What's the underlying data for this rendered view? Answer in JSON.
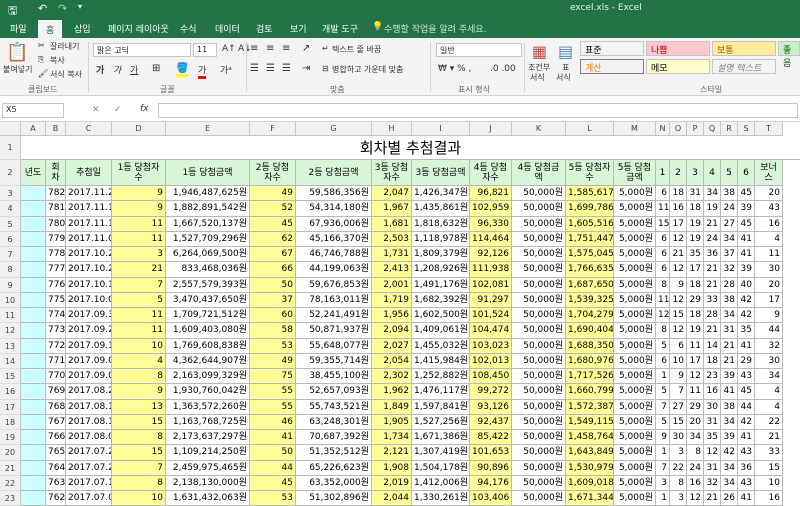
{
  "titlebar": {
    "title": "excel.xls - Excel",
    "save_icon": "save-icon",
    "undo_icon": "undo-icon",
    "redo_icon": "redo-icon"
  },
  "tabs": [
    "파일",
    "홈",
    "삽입",
    "페이지 레이아웃",
    "수식",
    "데이터",
    "검토",
    "보기",
    "개발 도구"
  ],
  "tell_me": "수행할 작업을 알려 주세요.",
  "ribbon": {
    "paste": "붙여넣기",
    "cut": "잘라내기",
    "copy": "복사",
    "format_painter": "서식 복사",
    "font": "맑은 고딕",
    "size": "11",
    "bold": "가",
    "italic": "가",
    "underline": "가",
    "wrap": "텍스트 줄 바꿈",
    "merge": "병합하고 가운데 맞춤",
    "number_format": "일반",
    "cond": "조건부",
    "cond2": "서식",
    "table_fmt": "표",
    "table_fmt2": "서식",
    "styles": [
      {
        "label": "표준",
        "bg": "#ffffff",
        "fg": "#000000"
      },
      {
        "label": "나쁨",
        "bg": "#ffc7ce",
        "fg": "#9c0006"
      },
      {
        "label": "보통",
        "bg": "#ffeb9c",
        "fg": "#9c6500"
      },
      {
        "label": "좋음",
        "bg": "#c6efce",
        "fg": "#006100"
      },
      {
        "label": "계산",
        "bg": "#f2f2f2",
        "fg": "#fa7d00"
      },
      {
        "label": "메모",
        "bg": "#ffffcc",
        "fg": "#000000"
      },
      {
        "label": "설명 텍스트",
        "bg": "#ffffff",
        "fg": "#7f7f7f"
      }
    ],
    "groups": [
      "클립보드",
      "글꼴",
      "맞춤",
      "표시 형식",
      "스타일"
    ]
  },
  "formula_bar": {
    "name_box": "X5",
    "fx": "fx",
    "value": ""
  },
  "columns": [
    "A",
    "B",
    "C",
    "D",
    "E",
    "F",
    "G",
    "H",
    "I",
    "J",
    "K",
    "L",
    "M",
    "N",
    "O",
    "P",
    "Q",
    "R",
    "S",
    "T"
  ],
  "sheet_title": "회차별 추첨결과",
  "headers": [
    "년도",
    "회차",
    "추첨일",
    "1등 당첨자수",
    "1등 당첨금액",
    "2등 당첨자수",
    "2등 당첨금액",
    "3등 당첨자수",
    "3등 당첨금액",
    "4등 당첨자수",
    "4등 당첨금액",
    "5등 당첨자수",
    "5등 당첨금액",
    "1",
    "2",
    "3",
    "4",
    "5",
    "6",
    "보너스"
  ],
  "rows": [
    [
      "",
      "782",
      "2017.11.25",
      "9",
      "1,946,487,625원",
      "49",
      "59,586,356원",
      "2,047",
      "1,426,347원",
      "96,821",
      "50,000원",
      "1,585,617",
      "5,000원",
      "6",
      "18",
      "31",
      "34",
      "38",
      "45",
      "20"
    ],
    [
      "",
      "781",
      "2017.11.18",
      "9",
      "1,882,891,542원",
      "52",
      "54,314,180원",
      "1,967",
      "1,435,861원",
      "102,959",
      "50,000원",
      "1,699,786",
      "5,000원",
      "11",
      "16",
      "18",
      "19",
      "24",
      "39",
      "43"
    ],
    [
      "",
      "780",
      "2017.11.11",
      "11",
      "1,667,520,137원",
      "45",
      "67,936,006원",
      "1,681",
      "1,818,632원",
      "96,330",
      "50,000원",
      "1,605,516",
      "5,000원",
      "15",
      "17",
      "19",
      "21",
      "27",
      "45",
      "16"
    ],
    [
      "",
      "779",
      "2017.11.04",
      "11",
      "1,527,709,296원",
      "62",
      "45,166,370원",
      "2,503",
      "1,118,978원",
      "114,464",
      "50,000원",
      "1,751,447",
      "5,000원",
      "6",
      "12",
      "19",
      "24",
      "34",
      "41",
      "4"
    ],
    [
      "",
      "778",
      "2017.10.28",
      "3",
      "6,264,069,500원",
      "67",
      "46,746,788원",
      "1,731",
      "1,809,379원",
      "92,126",
      "50,000원",
      "1,575,045",
      "5,000원",
      "6",
      "21",
      "35",
      "36",
      "37",
      "41",
      "11"
    ],
    [
      "",
      "777",
      "2017.10.21",
      "21",
      "833,468,036원",
      "66",
      "44,199,063원",
      "2,413",
      "1,208,926원",
      "111,938",
      "50,000원",
      "1,766,635",
      "5,000원",
      "6",
      "12",
      "17",
      "21",
      "32",
      "39",
      "30"
    ],
    [
      "",
      "776",
      "2017.10.14",
      "7",
      "2,557,579,393원",
      "50",
      "59,676,853원",
      "2,001",
      "1,491,176원",
      "102,081",
      "50,000원",
      "1,687,650",
      "5,000원",
      "8",
      "9",
      "18",
      "21",
      "28",
      "40",
      "20"
    ],
    [
      "",
      "775",
      "2017.10.07",
      "5",
      "3,470,437,650원",
      "37",
      "78,163,011원",
      "1,719",
      "1,682,392원",
      "91,297",
      "50,000원",
      "1,539,325",
      "5,000원",
      "11",
      "12",
      "29",
      "33",
      "38",
      "42",
      "17"
    ],
    [
      "",
      "774",
      "2017.09.30",
      "11",
      "1,709,721,512원",
      "60",
      "52,241,491원",
      "1,956",
      "1,602,500원",
      "101,524",
      "50,000원",
      "1,704,279",
      "5,000원",
      "12",
      "15",
      "18",
      "28",
      "34",
      "42",
      "9"
    ],
    [
      "",
      "773",
      "2017.09.23",
      "11",
      "1,609,403,080원",
      "58",
      "50,871,937원",
      "2,094",
      "1,409,061원",
      "104,474",
      "50,000원",
      "1,690,404",
      "5,000원",
      "8",
      "12",
      "19",
      "21",
      "31",
      "35",
      "44"
    ],
    [
      "",
      "772",
      "2017.09.16",
      "10",
      "1,769,608,838원",
      "53",
      "55,648,077원",
      "2,027",
      "1,455,032원",
      "103,023",
      "50,000원",
      "1,688,350",
      "5,000원",
      "5",
      "6",
      "11",
      "14",
      "21",
      "41",
      "32"
    ],
    [
      "",
      "771",
      "2017.09.09",
      "4",
      "4,362,644,907원",
      "49",
      "59,355,714원",
      "2,054",
      "1,415,984원",
      "102,013",
      "50,000원",
      "1,680,976",
      "5,000원",
      "6",
      "10",
      "17",
      "18",
      "21",
      "29",
      "30"
    ],
    [
      "",
      "770",
      "2017.09.02",
      "8",
      "2,163,099,329원",
      "75",
      "38,455,100원",
      "2,302",
      "1,252,882원",
      "108,450",
      "50,000원",
      "1,717,526",
      "5,000원",
      "1",
      "9",
      "12",
      "23",
      "39",
      "43",
      "34"
    ],
    [
      "",
      "769",
      "2017.08.26",
      "9",
      "1,930,760,042원",
      "55",
      "52,657,093원",
      "1,962",
      "1,476,117원",
      "99,272",
      "50,000원",
      "1,660,799",
      "5,000원",
      "5",
      "7",
      "11",
      "16",
      "41",
      "45",
      "4"
    ],
    [
      "",
      "768",
      "2017.08.19",
      "13",
      "1,363,572,260원",
      "55",
      "55,743,521원",
      "1,849",
      "1,597,841원",
      "93,126",
      "50,000원",
      "1,572,387",
      "5,000원",
      "7",
      "27",
      "29",
      "30",
      "38",
      "44",
      "4"
    ],
    [
      "",
      "767",
      "2017.08.12",
      "15",
      "1,163,768,725원",
      "46",
      "63,248,301원",
      "1,905",
      "1,527,256원",
      "92,437",
      "50,000원",
      "1,549,115",
      "5,000원",
      "5",
      "15",
      "20",
      "31",
      "34",
      "42",
      "22"
    ],
    [
      "",
      "766",
      "2017.08.05",
      "8",
      "2,173,637,297원",
      "41",
      "70,687,392원",
      "1,734",
      "1,671,386원",
      "85,422",
      "50,000원",
      "1,458,764",
      "5,000원",
      "9",
      "30",
      "34",
      "35",
      "39",
      "41",
      "21"
    ],
    [
      "",
      "765",
      "2017.07.29",
      "15",
      "1,109,214,250원",
      "50",
      "51,352,512원",
      "2,121",
      "1,307,419원",
      "101,653",
      "50,000원",
      "1,643,849",
      "5,000원",
      "1",
      "3",
      "8",
      "12",
      "42",
      "43",
      "33"
    ],
    [
      "",
      "764",
      "2017.07.22",
      "7",
      "2,459,975,465원",
      "44",
      "65,226,623원",
      "1,908",
      "1,504,178원",
      "90,896",
      "50,000원",
      "1,530,979",
      "5,000원",
      "7",
      "22",
      "24",
      "31",
      "34",
      "36",
      "15"
    ],
    [
      "",
      "763",
      "2017.07.15",
      "8",
      "2,138,130,000원",
      "45",
      "63,352,000원",
      "2,019",
      "1,412,006원",
      "94,176",
      "50,000원",
      "1,609,018",
      "5,000원",
      "3",
      "8",
      "16",
      "32",
      "34",
      "43",
      "10"
    ],
    [
      "",
      "762",
      "2017.07.08",
      "10",
      "1,631,432,063원",
      "53",
      "51,302,896원",
      "2,044",
      "1,330,261원",
      "103,406",
      "50,000원",
      "1,671,344",
      "5,000원",
      "1",
      "3",
      "12",
      "21",
      "26",
      "41",
      "16"
    ],
    [
      "",
      "761",
      "2017.07.01",
      "7",
      "2,392,730,518원",
      "52",
      "53,683,057원",
      "2,139",
      "1,305,058원",
      "101,503",
      "50,000원",
      "1,660,130",
      "5,000원",
      "4",
      "7",
      "11",
      "24",
      "42",
      "45",
      "30"
    ]
  ],
  "row_numbers": [
    "1",
    "2",
    "3",
    "4",
    "5",
    "6",
    "7",
    "8",
    "9",
    "10",
    "11",
    "12",
    "13",
    "14",
    "15",
    "16",
    "17",
    "18",
    "19",
    "20",
    "21",
    "22",
    "23",
    "24"
  ],
  "colors": {
    "header_green": "#d8f5d8",
    "yellow": "#ffff99",
    "cyan": "#ccffff",
    "excel_green": "#217346"
  }
}
